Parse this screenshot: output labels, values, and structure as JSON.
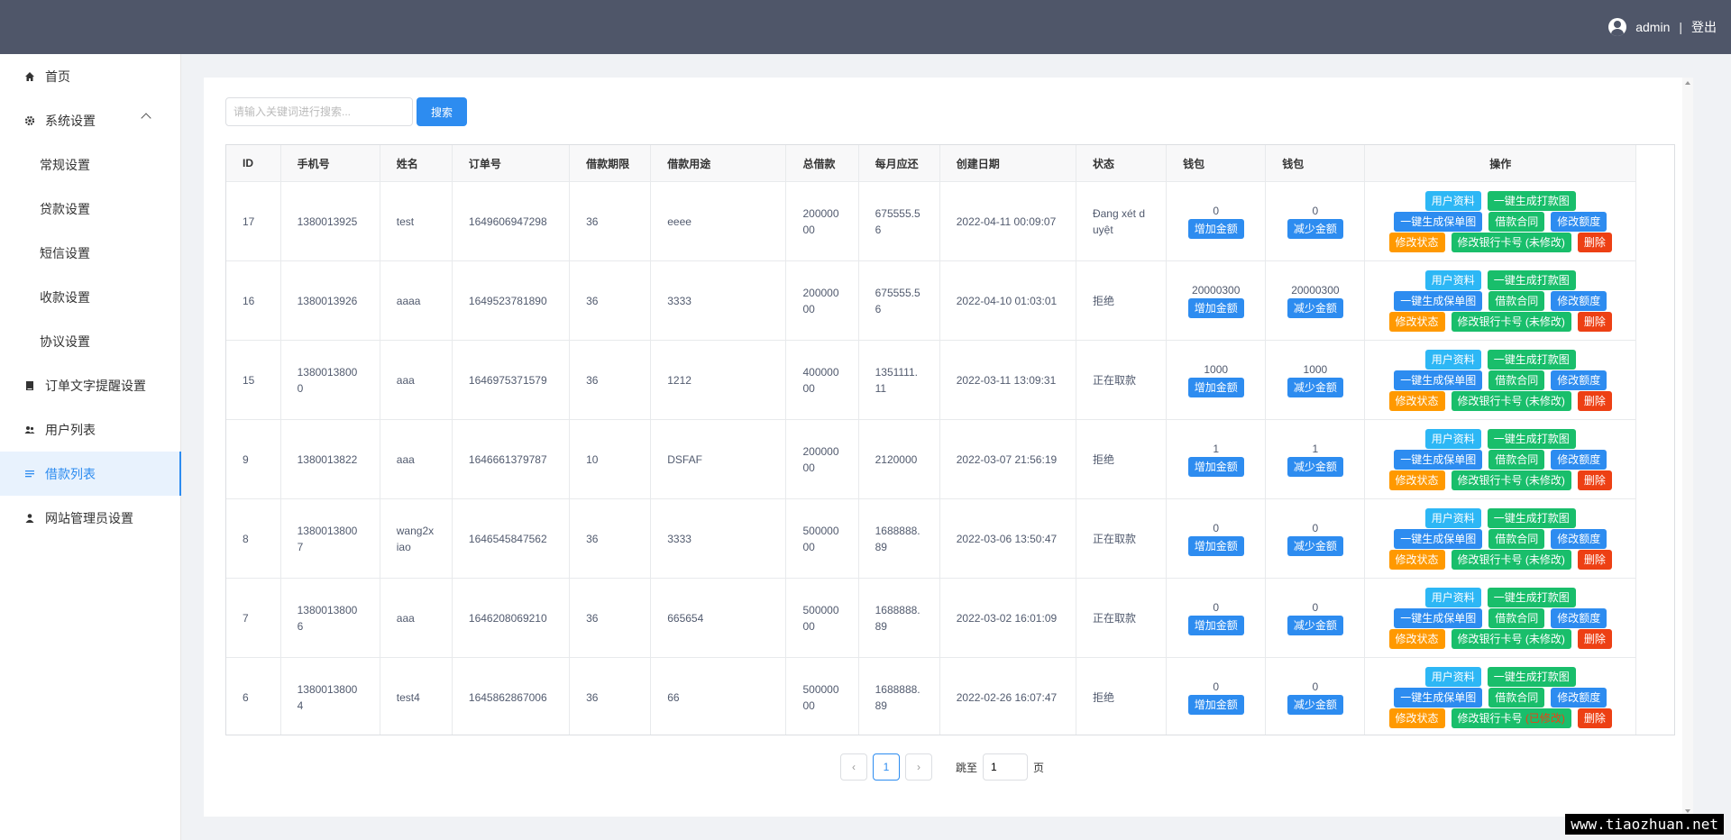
{
  "header": {
    "username": "admin",
    "separator": "|",
    "logout": "登出"
  },
  "sidebar": {
    "items": [
      {
        "label": "首页"
      },
      {
        "label": "系统设置"
      },
      {
        "label": "常规设置"
      },
      {
        "label": "贷款设置"
      },
      {
        "label": "短信设置"
      },
      {
        "label": "收款设置"
      },
      {
        "label": "协议设置"
      },
      {
        "label": "订单文字提醒设置"
      },
      {
        "label": "用户列表"
      },
      {
        "label": "借款列表"
      },
      {
        "label": "网站管理员设置"
      }
    ]
  },
  "search": {
    "placeholder": "请输入关键词进行搜索...",
    "button": "搜索"
  },
  "table": {
    "headers": [
      "ID",
      "手机号",
      "姓名",
      "订单号",
      "借款期限",
      "借款用途",
      "总借款",
      "每月应还",
      "创建日期",
      "状态",
      "钱包",
      "钱包",
      "操作"
    ],
    "wallet_add": "增加金额",
    "wallet_sub": "减少金额",
    "op_labels": {
      "profile": "用户资料",
      "gen_payment": "一键生成打款图",
      "gen_policy": "一键生成保单图",
      "contract": "借款合同",
      "limit": "修改额度",
      "status": "修改状态",
      "bank": "修改银行卡号",
      "delete": "删除"
    },
    "rows": [
      {
        "id": "17",
        "phone": "1380013925",
        "name": "test",
        "order": "1649606947298",
        "term": "36",
        "purpose": "eeee",
        "total": "20000000",
        "monthly": "675555.56",
        "date": "2022-04-11 00:09:07",
        "status": "Đang xét duyệt",
        "wallet1": "0",
        "wallet2": "0",
        "bank_tail": "(未修改)"
      },
      {
        "id": "16",
        "phone": "1380013926",
        "name": "aaaa",
        "order": "1649523781890",
        "term": "36",
        "purpose": "3333",
        "total": "20000000",
        "monthly": "675555.56",
        "date": "2022-04-10 01:03:01",
        "status": "拒绝",
        "wallet1": "20000300",
        "wallet2": "20000300",
        "bank_tail": "(未修改)"
      },
      {
        "id": "15",
        "phone": "13800138000",
        "name": "aaa",
        "order": "1646975371579",
        "term": "36",
        "purpose": "1212",
        "total": "40000000",
        "monthly": "1351111.11",
        "date": "2022-03-11 13:09:31",
        "status": "正在取款",
        "wallet1": "1000",
        "wallet2": "1000",
        "bank_tail": "(未修改)"
      },
      {
        "id": "9",
        "phone": "1380013822",
        "name": "aaa",
        "order": "1646661379787",
        "term": "10",
        "purpose": "DSFAF",
        "total": "20000000",
        "monthly": "2120000",
        "date": "2022-03-07 21:56:19",
        "status": "拒绝",
        "wallet1": "1",
        "wallet2": "1",
        "bank_tail": "(未修改)"
      },
      {
        "id": "8",
        "phone": "13800138007",
        "name": "wang2xiao",
        "order": "1646545847562",
        "term": "36",
        "purpose": "3333",
        "total": "50000000",
        "monthly": "1688888.89",
        "date": "2022-03-06 13:50:47",
        "status": "正在取款",
        "wallet1": "0",
        "wallet2": "0",
        "bank_tail": "(未修改)"
      },
      {
        "id": "7",
        "phone": "13800138006",
        "name": "aaa",
        "order": "1646208069210",
        "term": "36",
        "purpose": "665654",
        "total": "50000000",
        "monthly": "1688888.89",
        "date": "2022-03-02 16:01:09",
        "status": "正在取款",
        "wallet1": "0",
        "wallet2": "0",
        "bank_tail": "(未修改)"
      },
      {
        "id": "6",
        "phone": "13800138004",
        "name": "test4",
        "order": "1645862867006",
        "term": "36",
        "purpose": "66",
        "total": "50000000",
        "monthly": "1688888.89",
        "date": "2022-02-26 16:07:47",
        "status": "拒绝",
        "wallet1": "0",
        "wallet2": "0",
        "bank_tail": "(已修改)"
      }
    ]
  },
  "pagination": {
    "prev": "‹",
    "current_page": "1",
    "next": "›",
    "jump_label": "跳至",
    "jump_value": "1",
    "page_suffix": "页"
  },
  "watermark": "www.tiaozhuan.net"
}
